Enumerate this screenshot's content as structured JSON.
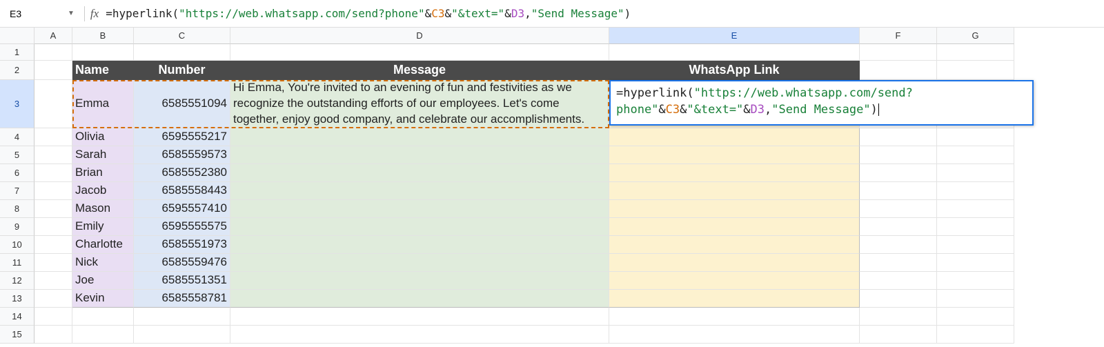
{
  "activeCell": "E3",
  "formula": {
    "func_open": "=hyperlink(",
    "str1": "\"https://web.whatsapp.com/send?phone\"",
    "amp1": "&",
    "ref1": "C3",
    "amp2": "&",
    "str2": "\"&text=\"",
    "amp3": "&",
    "ref2": "D3",
    "comma": ",",
    "str3": "\"Send Message\"",
    "close": ")"
  },
  "columns": [
    "A",
    "B",
    "C",
    "D",
    "E",
    "F",
    "G"
  ],
  "headerRow": {
    "B": "Name",
    "C": "Number",
    "D": "Message",
    "E": "WhatsApp Link"
  },
  "rows": [
    {
      "r": 3,
      "name": "Emma",
      "number": "6585551094",
      "message": "Hi Emma, You're invited to an evening of fun and festivities as we recognize the outstanding efforts of our employees. Let's come together, enjoy good company, and celebrate our accomplishments."
    },
    {
      "r": 4,
      "name": "Olivia",
      "number": "6595555217",
      "message": ""
    },
    {
      "r": 5,
      "name": "Sarah",
      "number": "6585559573",
      "message": ""
    },
    {
      "r": 6,
      "name": "Brian",
      "number": "6585552380",
      "message": ""
    },
    {
      "r": 7,
      "name": "Jacob",
      "number": "6585558443",
      "message": ""
    },
    {
      "r": 8,
      "name": "Mason",
      "number": "6595557410",
      "message": ""
    },
    {
      "r": 9,
      "name": "Emily",
      "number": "6595555575",
      "message": ""
    },
    {
      "r": 10,
      "name": "Charlotte",
      "number": "6585551973",
      "message": ""
    },
    {
      "r": 11,
      "name": "Nick",
      "number": "6585559476",
      "message": ""
    },
    {
      "r": 12,
      "name": "Joe",
      "number": "6585551351",
      "message": ""
    },
    {
      "r": 13,
      "name": "Kevin",
      "number": "6585558781",
      "message": ""
    }
  ],
  "emptyRows": [
    1,
    14,
    15
  ],
  "editingText": {
    "func_open": "=hyperlink(",
    "str1": "\"https://web.whatsapp.com/send?phone\"",
    "amp1": "&",
    "ref1": "C3",
    "amp2": "&",
    "str2": "\"&text=\"",
    "amp3": "&",
    "ref2": "D3",
    "comma": ",",
    "str3": "\"Send Message\"",
    "close": ")"
  }
}
